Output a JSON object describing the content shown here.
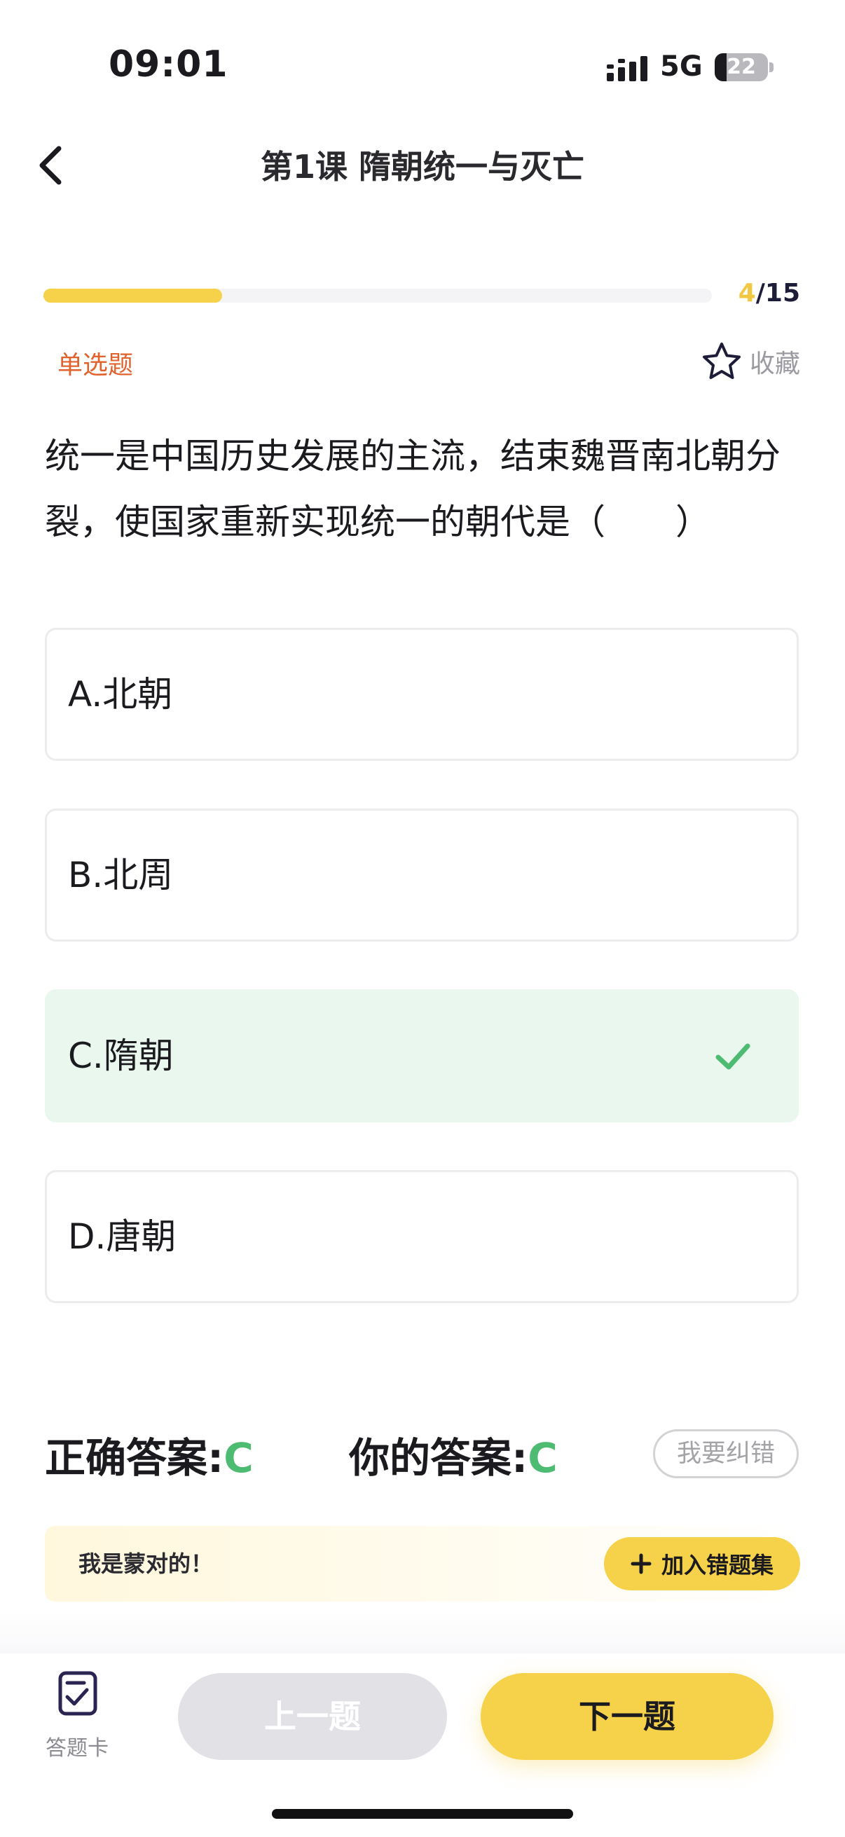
{
  "status_bar": {
    "time": "09:01",
    "network": "5G",
    "battery": "22"
  },
  "nav": {
    "title": "第1课 隋朝统一与灭亡"
  },
  "progress": {
    "current": "4",
    "total": "/15",
    "fraction": 0.267
  },
  "question": {
    "type": "单选题",
    "favorite_label": "收藏",
    "text": "统一是中国历史发展的主流，结束魏晋南北朝分裂，使国家重新实现统一的朝代是（　　）",
    "options": [
      {
        "label": "A.北朝",
        "correct": false
      },
      {
        "label": "B.北周",
        "correct": false
      },
      {
        "label": "C.隋朝",
        "correct": true
      },
      {
        "label": "D.唐朝",
        "correct": false
      }
    ]
  },
  "answers": {
    "correct_label": "正确答案:",
    "correct_value": "C",
    "yours_label": "你的答案:",
    "yours_value": "C",
    "report_button": "我要纠错"
  },
  "note": {
    "text": "我是蒙对的！",
    "add_button": "加入错题集"
  },
  "bottom_bar": {
    "answer_card_label": "答题卡",
    "prev_label": "上一题",
    "next_label": "下一题"
  },
  "colors": {
    "accent": "#f6d24a",
    "correct": "#4dbb72",
    "question_type": "#e0632d",
    "correct_option_bg": "#eaf7ee"
  },
  "icons": {
    "back": "chevron-left-icon",
    "favorite": "star-outline-icon",
    "check": "check-icon",
    "add": "plus-icon",
    "answer_card": "answer-card-icon"
  }
}
